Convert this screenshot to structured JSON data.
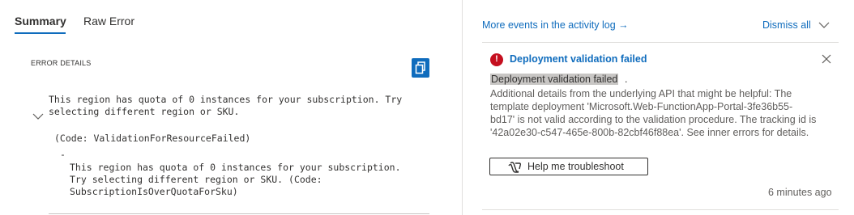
{
  "tabs": {
    "summary": "Summary",
    "raw_error": "Raw Error"
  },
  "error_details": {
    "label": "ERROR DETAILS",
    "message_line1": "This region has quota of 0 instances for your subscription. Try",
    "message_line2": "selecting different region or SKU.",
    "code": "(Code: ValidationForResourceFailed)",
    "dash": "-",
    "inner_line1": "This region has quota of 0 instances for your subscription.",
    "inner_line2": "Try selecting different region or SKU. (Code:",
    "inner_line3": "SubscriptionIsOverQuotaForSku)"
  },
  "notifications": {
    "more_events_link": "More events in the activity log →",
    "dismiss_all": "Dismiss all",
    "item": {
      "title": "Deployment validation failed",
      "message_highlight": "Deployment validation failed",
      "message_tail": ".",
      "desc_line1": "Additional details from the underlying API that might be helpful: The",
      "desc_line2": "template deployment 'Microsoft.Web-FunctionApp-Portal-3fe36b55-",
      "desc_line3": "bd17' is not valid according to the validation procedure. The tracking id is",
      "desc_line4": "'42a02e30-c547-465e-800b-82cbf46f88ea'. See inner errors for details.",
      "help_button": "Help me troubleshoot",
      "timestamp": "6 minutes ago"
    }
  },
  "colors": {
    "accent": "#0f6cbd",
    "error": "#c50f1f",
    "highlight": "#c8c6c4"
  },
  "icons": [
    "copy-icon",
    "chevron-down-icon",
    "error-icon",
    "close-icon",
    "copilot-icon"
  ]
}
